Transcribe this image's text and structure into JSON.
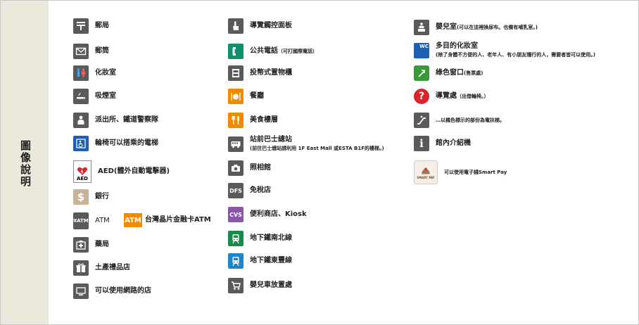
{
  "sidebar": {
    "title": "圖像說明"
  },
  "col1": [
    {
      "label": "郵局"
    },
    {
      "label": "郵筒"
    },
    {
      "label": "化妝室"
    },
    {
      "label": "吸煙室"
    },
    {
      "label": "派出所、鐵道警察隊"
    },
    {
      "label": "輪椅可以搭乘的電梯"
    },
    {
      "label": "AED(體外自動電擊器)",
      "icon_text": "AED"
    },
    {
      "label": "銀行",
      "icon_text": "$"
    },
    {
      "label": "ATM",
      "icon_text": "¥ATM"
    },
    {
      "label": "藥局"
    },
    {
      "label": "土產禮品店"
    },
    {
      "label": "可以使用網路的店"
    }
  ],
  "atm_card": {
    "icon_text": "ATM",
    "label": "台灣晶片金融卡ATM"
  },
  "col2": [
    {
      "label": "導覽觸控面板"
    },
    {
      "label": "公共電話",
      "note": "（可打國際電話）"
    },
    {
      "label": "投幣式置物櫃"
    },
    {
      "label": "餐廳"
    },
    {
      "label": "美食樓層"
    },
    {
      "label": "站前巴士總站",
      "note": "(前往巴士總站請利用 1F East Mall 或ESTA B1F的樓梯。)"
    },
    {
      "label": "照相館"
    },
    {
      "label": "免稅店",
      "icon_text": "DFS"
    },
    {
      "label": "便利商店、Kiosk",
      "icon_text": "CVS"
    },
    {
      "label": "地下鐵南北線"
    },
    {
      "label": "地下鐵東豐線"
    },
    {
      "label": "嬰兒車放置處"
    }
  ],
  "col3": [
    {
      "label": "嬰兒室",
      "note": "(可以在這裡換尿布。也備有哺乳室。)"
    },
    {
      "label": "多目的化妝室",
      "note": "(除了身體不方便的人、老年人、有小朋友隨行的人，需要者皆可以使用。)",
      "icon_text": "WC"
    },
    {
      "label": "綠色窗口",
      "note": "(售票處)"
    },
    {
      "label": "導覽處",
      "note": "（出借輪椅。）",
      "icon_text": "?"
    },
    {
      "label": "",
      "note": "…以橘色標示的部份為電扶梯。"
    },
    {
      "label": "館內介紹機",
      "icon_text": "i"
    },
    {
      "label": "",
      "note": "可以使用電子錢Smart Pay",
      "icon_text": "SMART PAY"
    }
  ]
}
